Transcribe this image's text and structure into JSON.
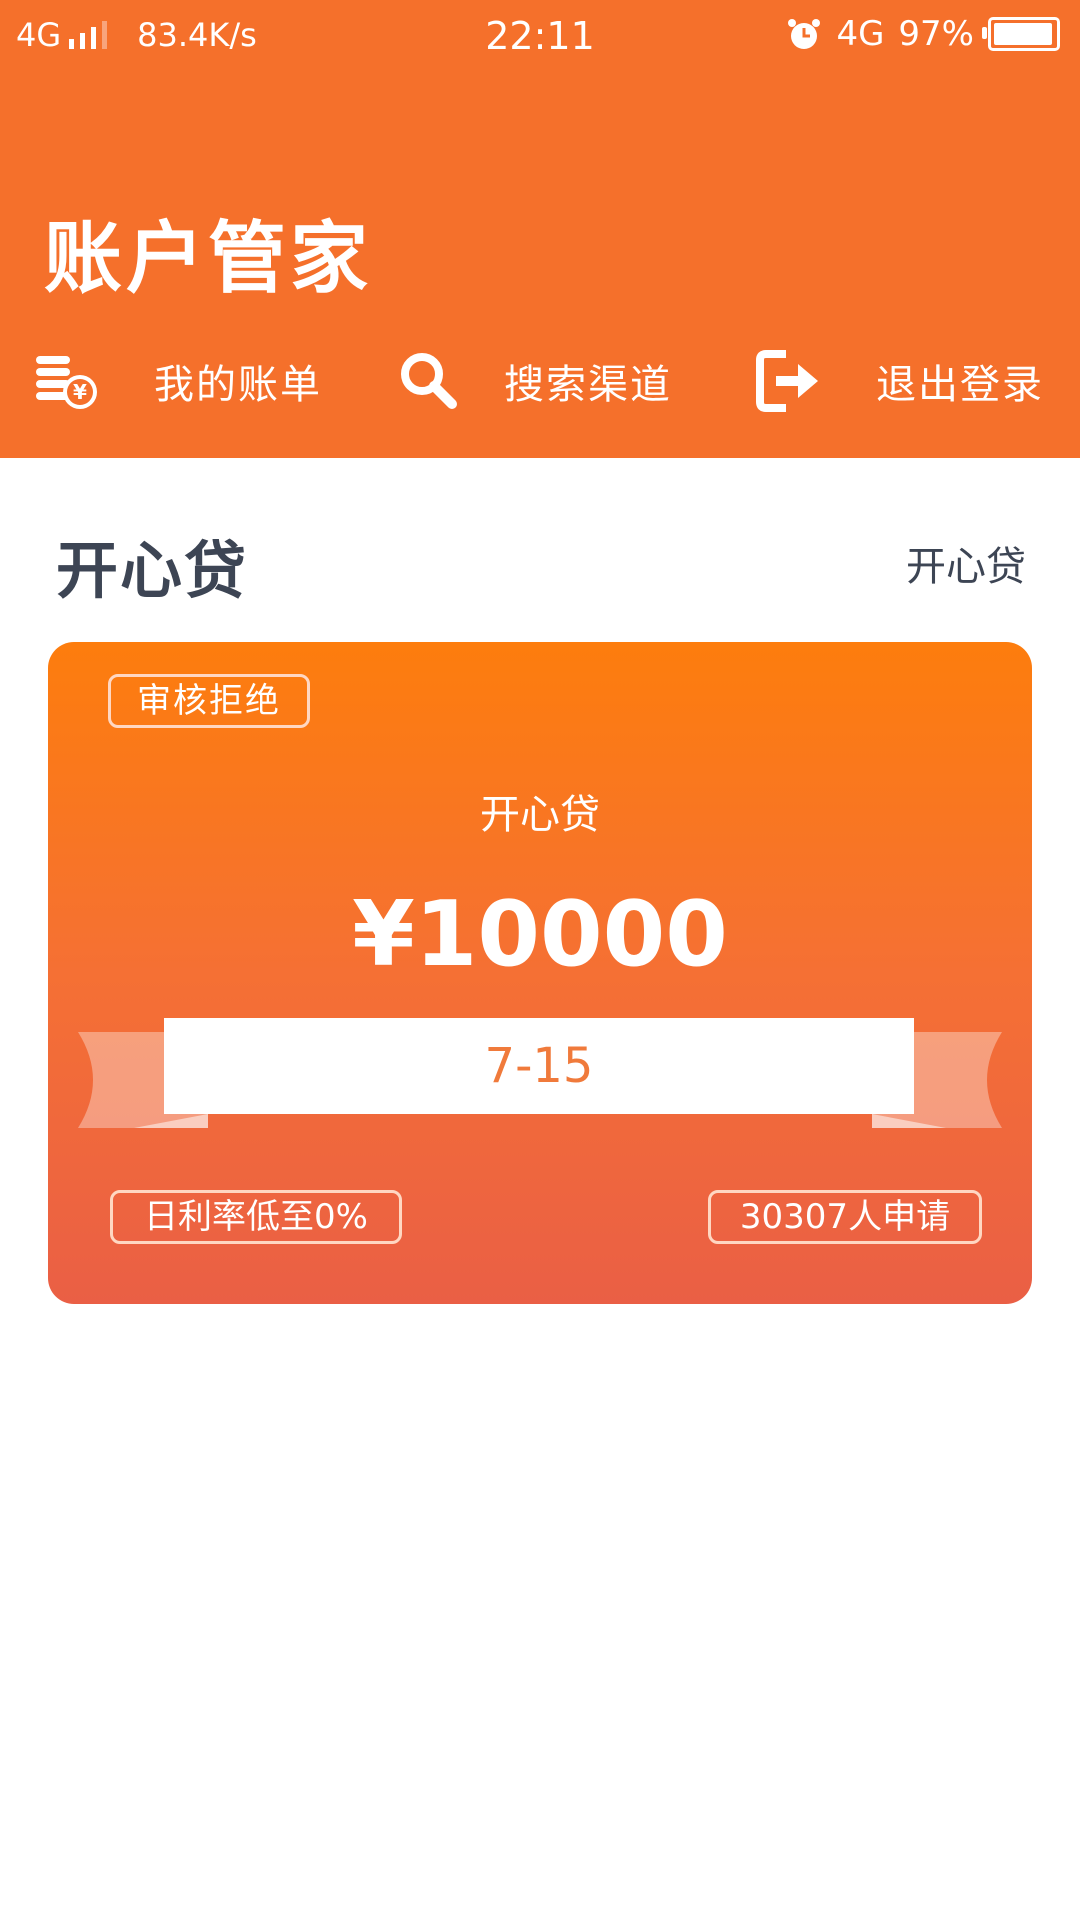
{
  "status_bar": {
    "network": "4G",
    "speed": "83.4K/s",
    "time": "22:11",
    "network_right": "4G",
    "battery": "97%"
  },
  "header": {
    "title": "账户管家",
    "nav": [
      {
        "label": "我的账单",
        "icon": "coins-yen-icon"
      },
      {
        "label": "搜索渠道",
        "icon": "search-icon"
      },
      {
        "label": "退出登录",
        "icon": "logout-icon"
      }
    ]
  },
  "section": {
    "title": "开心贷",
    "link": "开心贷"
  },
  "card": {
    "status": "审核拒绝",
    "name": "开心贷",
    "amount": "¥10000",
    "term": "7-15",
    "rate": "日利率低至0%",
    "applicants": "30307人申请"
  },
  "colors": {
    "brand": "#f5702b",
    "card_top": "#fd7d0d",
    "card_bottom": "#ea5f45",
    "title_text": "#3d4554",
    "term_text": "#f07a3b"
  }
}
